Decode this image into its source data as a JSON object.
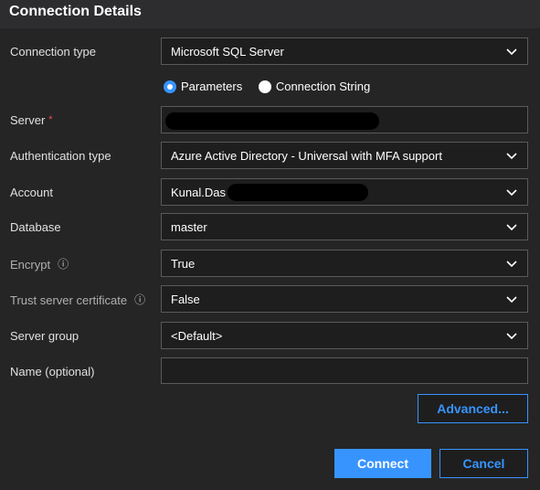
{
  "dialog": {
    "title": "Connection Details"
  },
  "fields": {
    "connection_type": {
      "label": "Connection type",
      "value": "Microsoft SQL Server"
    },
    "input_mode": {
      "options": [
        {
          "label": "Parameters",
          "selected": true
        },
        {
          "label": "Connection String",
          "selected": false
        }
      ]
    },
    "server": {
      "label": "Server",
      "required_mark": "*",
      "value": ""
    },
    "authentication_type": {
      "label": "Authentication type",
      "value": "Azure Active Directory - Universal with MFA support"
    },
    "account": {
      "label": "Account",
      "value": "Kunal.Das"
    },
    "database": {
      "label": "Database",
      "value": "master"
    },
    "encrypt": {
      "label": "Encrypt",
      "info_icon": "ⓘ",
      "value": "True"
    },
    "trust_server_certificate": {
      "label": "Trust server certificate",
      "info_icon": "ⓘ",
      "value": "False"
    },
    "server_group": {
      "label": "Server group",
      "value": "<Default>"
    },
    "name": {
      "label": "Name (optional)",
      "value": ""
    }
  },
  "buttons": {
    "advanced": "Advanced...",
    "connect": "Connect",
    "cancel": "Cancel"
  },
  "colors": {
    "accent": "#3794ff",
    "required": "#f14c4c",
    "background": "#252526",
    "field_background": "#1e1e1e",
    "redaction": "#000000"
  },
  "icons": {
    "dropdown": "chevron-down-icon",
    "info": "info-icon",
    "radio": "radio-icon"
  }
}
